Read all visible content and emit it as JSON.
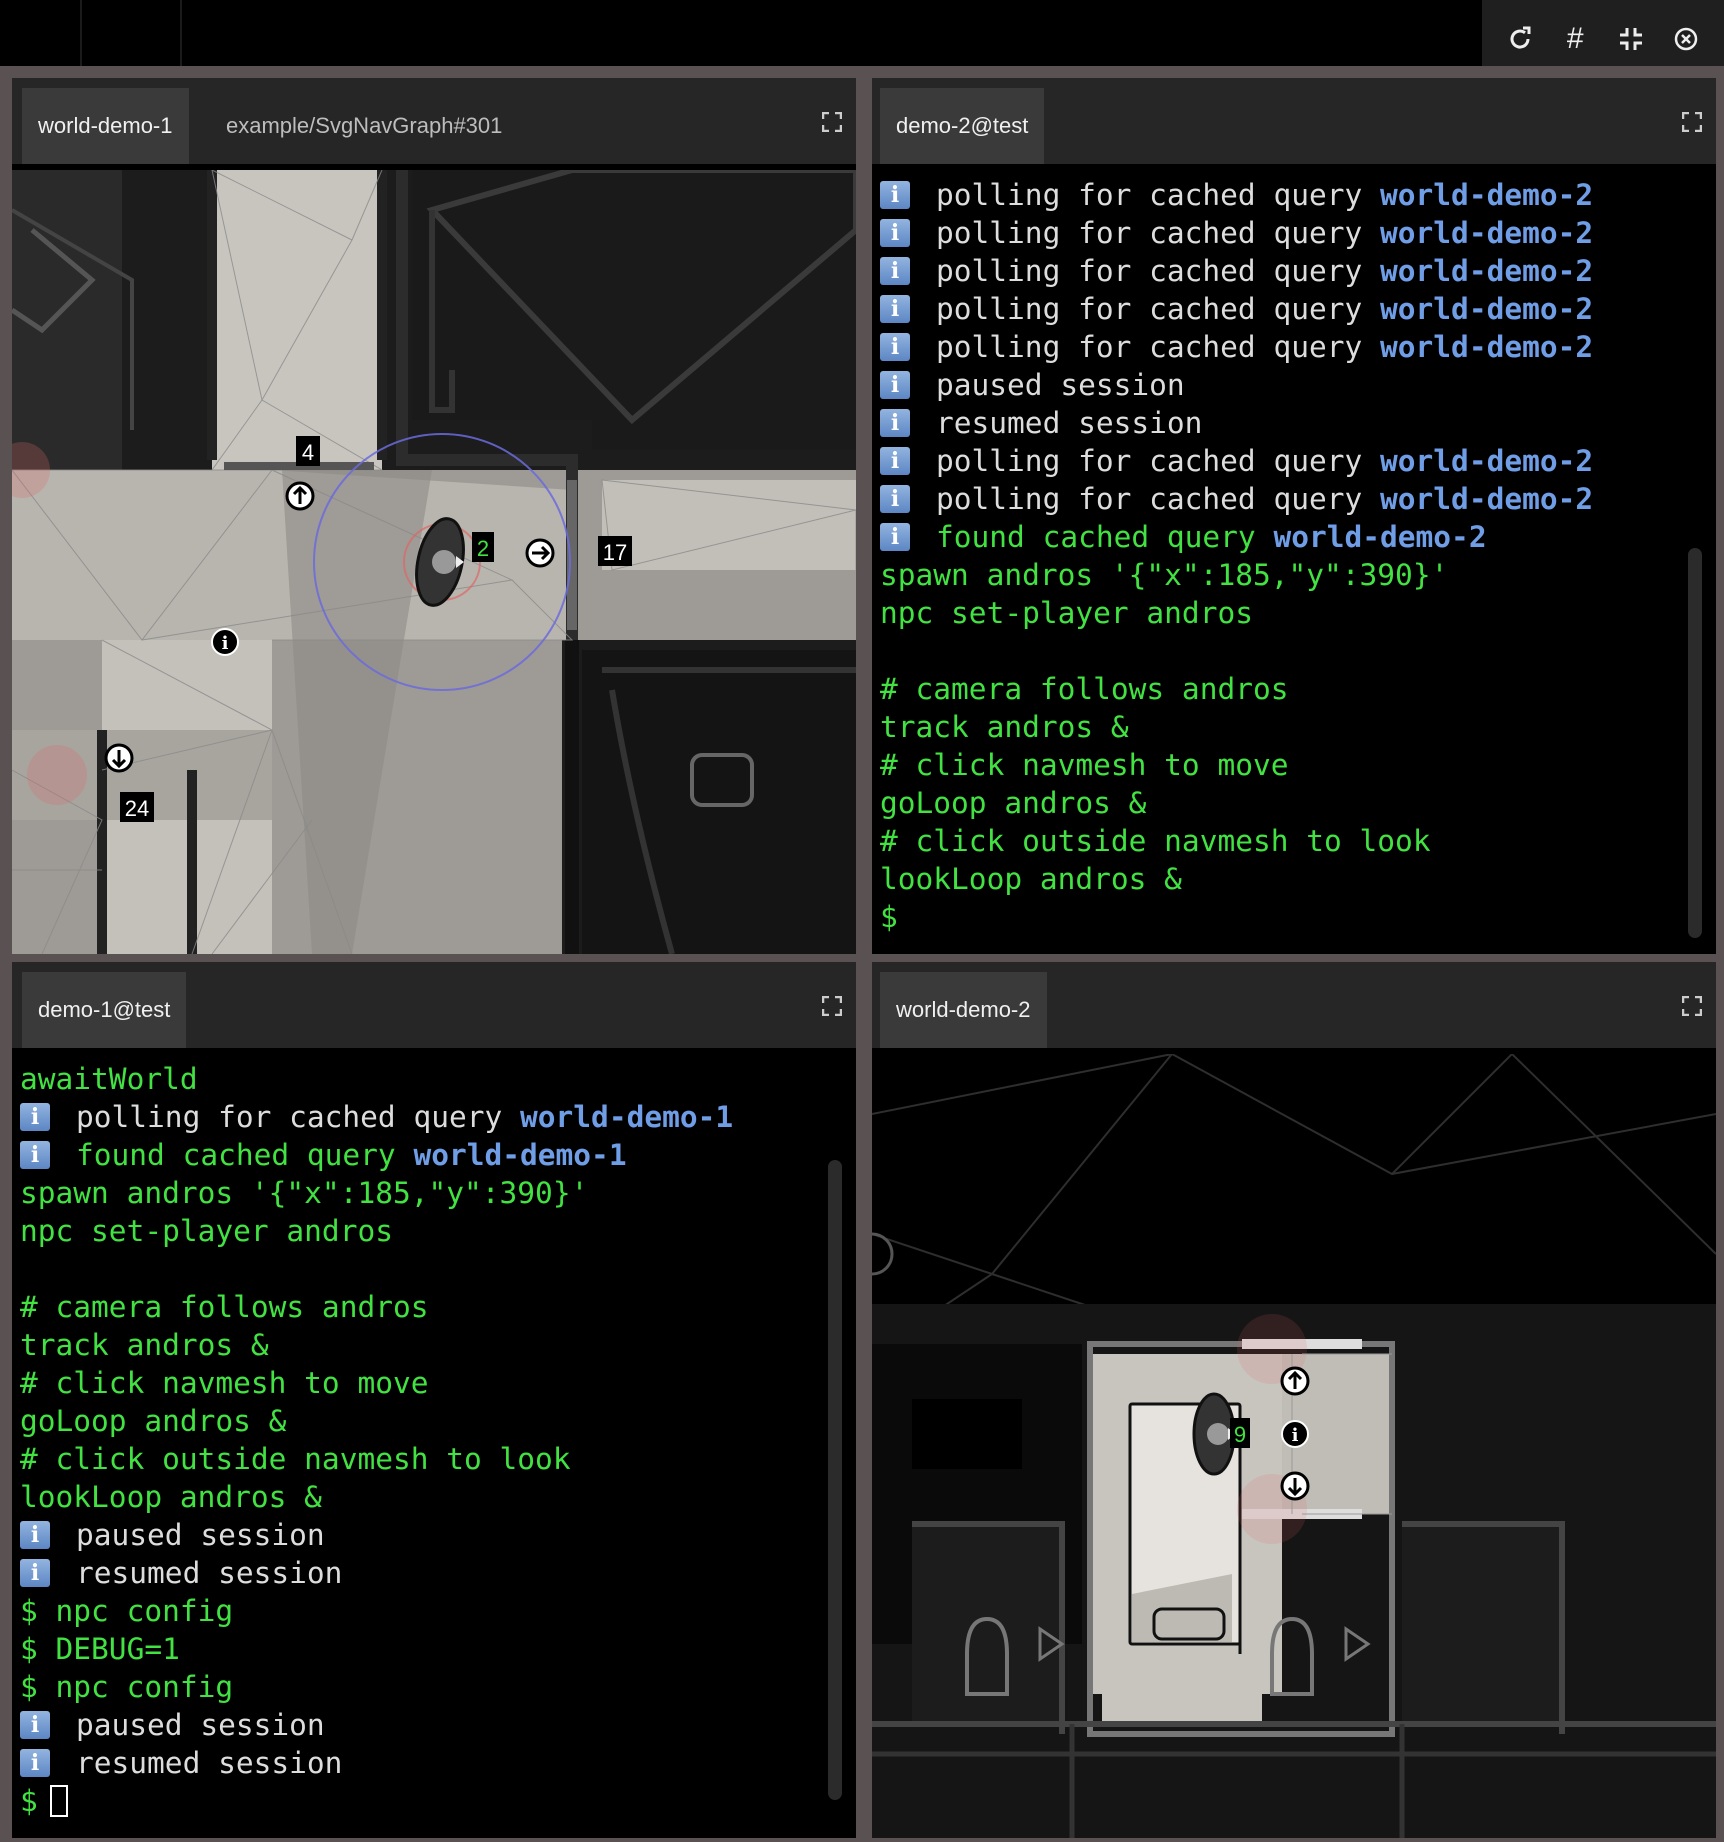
{
  "window_controls": {
    "refresh_glyph": "⟳",
    "grid_glyph": "#",
    "shrink_glyph": "⛶",
    "close_glyph": "⊗"
  },
  "panes": {
    "tl": {
      "tabs": [
        "world-demo-1",
        "example/SvgNavGraph#301"
      ],
      "labels": [
        "4",
        "2",
        "17",
        "24"
      ]
    },
    "tr": {
      "tabs": [
        "demo-2@test"
      ]
    },
    "bl": {
      "tabs": [
        "demo-1@test"
      ]
    },
    "br": {
      "tabs": [
        "world-demo-2"
      ],
      "labels": [
        "9"
      ]
    }
  },
  "terminal_demo2": [
    [
      "info",
      "polling for cached query ",
      "world-demo-2"
    ],
    [
      "info",
      "polling for cached query ",
      "world-demo-2"
    ],
    [
      "info",
      "polling for cached query ",
      "world-demo-2"
    ],
    [
      "info",
      "polling for cached query ",
      "world-demo-2"
    ],
    [
      "info",
      "polling for cached query ",
      "world-demo-2"
    ],
    [
      "info",
      "paused session",
      ""
    ],
    [
      "info",
      "resumed session",
      ""
    ],
    [
      "info",
      "polling for cached query ",
      "world-demo-2"
    ],
    [
      "info",
      "polling for cached query ",
      "world-demo-2"
    ],
    [
      "found",
      "found cached query ",
      "world-demo-2"
    ],
    [
      "cmd",
      "spawn andros '{\"x\":185,\"y\":390}'",
      ""
    ],
    [
      "cmd",
      "npc set-player andros",
      ""
    ],
    [
      "cmd",
      "",
      ""
    ],
    [
      "cmd",
      "# camera follows andros",
      ""
    ],
    [
      "cmd",
      "track andros &",
      ""
    ],
    [
      "cmd",
      "# click navmesh to move",
      ""
    ],
    [
      "cmd",
      "goLoop andros &",
      ""
    ],
    [
      "cmd",
      "# click outside navmesh to look",
      ""
    ],
    [
      "cmd",
      "lookLoop andros &",
      ""
    ],
    [
      "cmd",
      "$",
      ""
    ]
  ],
  "terminal_demo1": [
    [
      "cmd",
      "awaitWorld",
      ""
    ],
    [
      "info",
      "polling for cached query ",
      "world-demo-1"
    ],
    [
      "found",
      "found cached query ",
      "world-demo-1"
    ],
    [
      "cmd",
      "spawn andros '{\"x\":185,\"y\":390}'",
      ""
    ],
    [
      "cmd",
      "npc set-player andros",
      ""
    ],
    [
      "cmd",
      "",
      ""
    ],
    [
      "cmd",
      "# camera follows andros",
      ""
    ],
    [
      "cmd",
      "track andros &",
      ""
    ],
    [
      "cmd",
      "# click navmesh to move",
      ""
    ],
    [
      "cmd",
      "goLoop andros &",
      ""
    ],
    [
      "cmd",
      "# click outside navmesh to look",
      ""
    ],
    [
      "cmd",
      "lookLoop andros &",
      ""
    ],
    [
      "info",
      "paused session",
      ""
    ],
    [
      "info",
      "resumed session",
      ""
    ],
    [
      "cmd",
      "$ npc config",
      ""
    ],
    [
      "cmd",
      "$ DEBUG=1",
      ""
    ],
    [
      "cmd",
      "$ npc config",
      ""
    ],
    [
      "info",
      "paused session",
      ""
    ],
    [
      "info",
      "resumed session",
      ""
    ],
    [
      "prompt",
      "$",
      ""
    ]
  ],
  "info_glyph": "i"
}
